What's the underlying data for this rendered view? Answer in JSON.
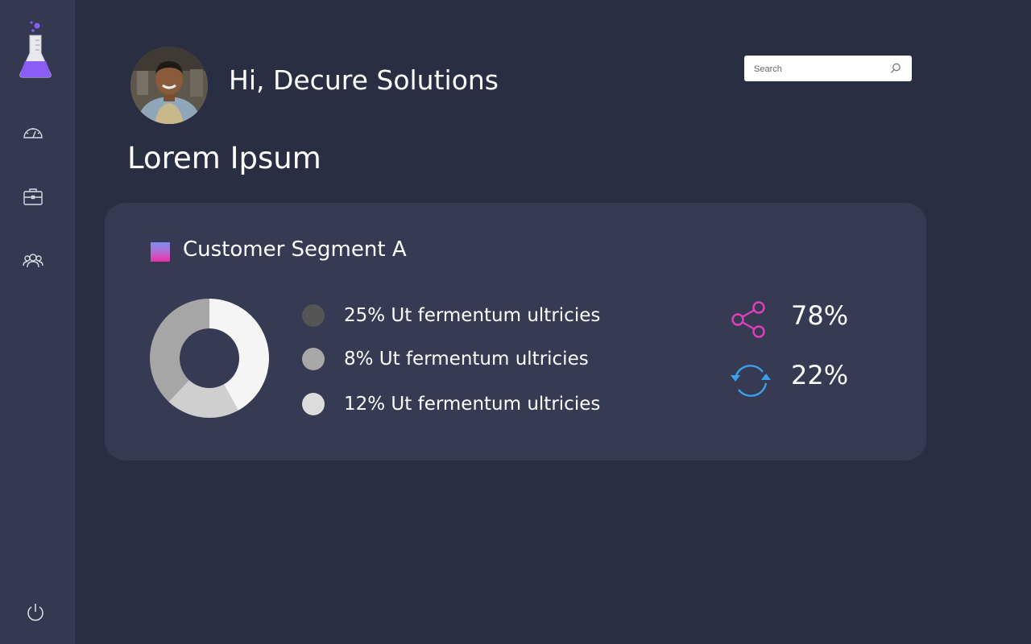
{
  "sidebar": {
    "logo_icon": "flask-icon",
    "items": [
      {
        "name": "dashboard",
        "icon": "speedometer-icon"
      },
      {
        "name": "briefcase",
        "icon": "briefcase-icon"
      },
      {
        "name": "users",
        "icon": "users-icon"
      }
    ],
    "bottom_icon": "power-icon"
  },
  "header": {
    "greeting": "Hi, Decure Solutions",
    "avatar_icon": "user-avatar"
  },
  "search": {
    "placeholder": "Search",
    "icon": "search-icon"
  },
  "page_title": "Lorem Ipsum",
  "segment": {
    "title": "Customer Segment A",
    "legend": [
      {
        "text": "25%  Ut fermentum ultricies",
        "color": "#555555"
      },
      {
        "text": "8% Ut fermentum ultricies",
        "color": "#a8a8a8"
      },
      {
        "text": "12% Ut fermentum ultricies",
        "color": "#dcdcdc"
      }
    ],
    "stats": [
      {
        "icon": "share-icon",
        "value": "78%",
        "color": "#e040b8"
      },
      {
        "icon": "refresh-icon",
        "value": "22%",
        "color": "#3aa0e8"
      }
    ]
  },
  "chart_data": {
    "type": "pie",
    "donut": true,
    "slices": [
      {
        "value": 42,
        "color": "#f5f5f5"
      },
      {
        "value": 20,
        "color": "#cfcfcf"
      },
      {
        "value": 38,
        "color": "#a6a6a6"
      }
    ]
  },
  "colors": {
    "background": "#2a2e42",
    "sidebar": "#343850",
    "card": "#363a52",
    "accent_purple": "#8b5cf6",
    "accent_pink": "#e040b8",
    "accent_blue": "#3aa0e8"
  }
}
